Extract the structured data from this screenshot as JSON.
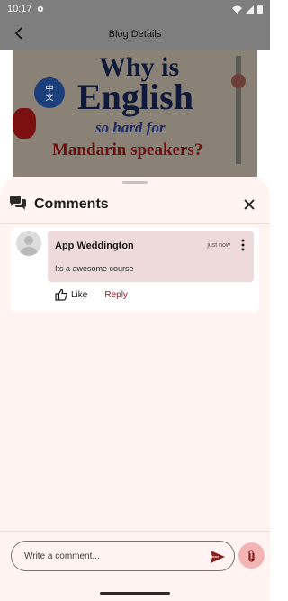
{
  "status_bar": {
    "time": "10:17"
  },
  "app_bar": {
    "title": "Blog Details"
  },
  "hero": {
    "line1": "Why is",
    "line2": "English",
    "line3": "so hard for",
    "line4": "Mandarin speakers?",
    "seal": "中\n文"
  },
  "sheet": {
    "title": "Comments",
    "comments": [
      {
        "author": "App Weddington",
        "time": "just now",
        "text": "Its a awesome course",
        "like_label": "Like",
        "reply_label": "Reply"
      }
    ]
  },
  "composer": {
    "placeholder": "Write a comment..."
  },
  "colors": {
    "accent": "#8a2020",
    "sheet_bg": "#fff4f1",
    "bubble_bg": "#eedada",
    "attach_bg": "#f3b4b4"
  },
  "icons": [
    "settings-icon",
    "wifi-icon",
    "signal-icon",
    "battery-icon",
    "back-arrow-icon",
    "comments-icon",
    "close-icon",
    "more-vert-icon",
    "thumb-up-icon",
    "send-icon",
    "attach-icon"
  ]
}
